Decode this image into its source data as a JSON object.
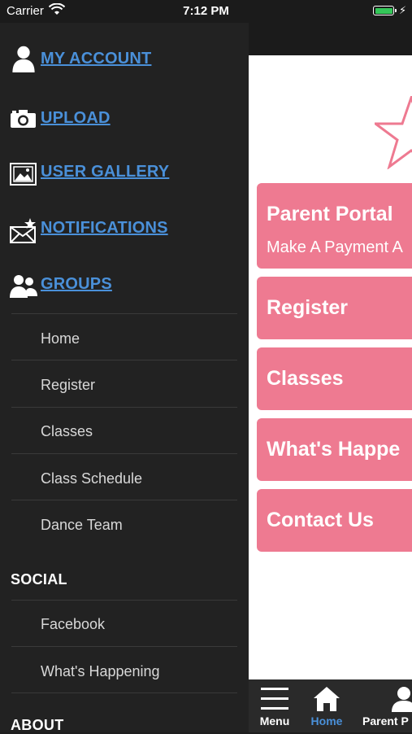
{
  "status_bar": {
    "carrier": "Carrier",
    "time": "7:12 PM",
    "battery_icon": "battery-charging-icon"
  },
  "drawer": {
    "primary_items": [
      {
        "label": "MY ACCOUNT",
        "icon": "person-icon"
      },
      {
        "label": "UPLOAD",
        "icon": "camera-icon"
      },
      {
        "label": "USER GALLERY",
        "icon": "gallery-icon"
      },
      {
        "label": "NOTIFICATIONS",
        "icon": "envelope-star-icon"
      },
      {
        "label": "GROUPS",
        "icon": "group-icon"
      }
    ],
    "nav_items": [
      "Home",
      "Register",
      "Classes",
      "Class Schedule",
      "Dance Team"
    ],
    "social_heading": "SOCIAL",
    "social_items": [
      "Facebook",
      "What's Happening"
    ],
    "about_heading": "ABOUT"
  },
  "main": {
    "cards": [
      {
        "title": "Parent Portal",
        "subtitle": "Make A Payment A"
      },
      {
        "title": "Register"
      },
      {
        "title": "Classes"
      },
      {
        "title": "What's Happe"
      },
      {
        "title": "Contact Us"
      }
    ],
    "accent_color": "#ee7a91"
  },
  "tab_bar": {
    "tabs": [
      {
        "label": "Menu",
        "icon": "hamburger-icon"
      },
      {
        "label": "Home",
        "icon": "home-icon",
        "active": true
      },
      {
        "label": "Parent P",
        "icon": "person-icon"
      }
    ],
    "active_color": "#4a90d9"
  }
}
